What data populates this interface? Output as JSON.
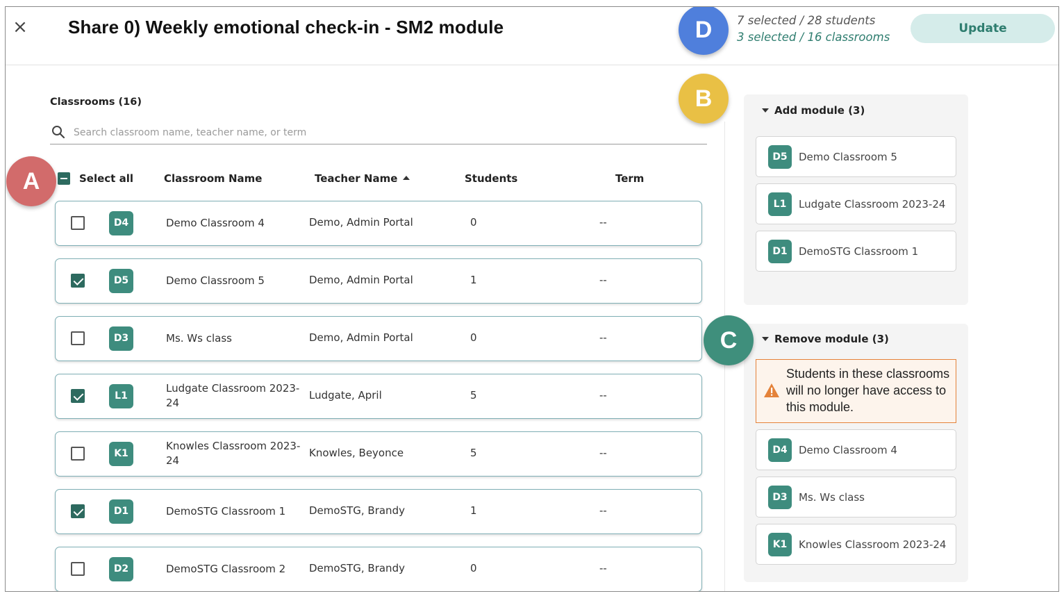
{
  "header": {
    "close_glyph": "×",
    "title": "Share 0) Weekly emotional check-in - SM2 module",
    "selection_students": "7 selected / 28 students",
    "selection_classrooms": "3 selected / 16 classrooms",
    "update_label": "Update"
  },
  "classrooms": {
    "heading": "Classrooms (16)",
    "search_placeholder": "Search classroom name, teacher name, or term",
    "columns": {
      "select_all": "Select all",
      "classroom_name": "Classroom Name",
      "teacher_name": "Teacher Name",
      "students": "Students",
      "term": "Term"
    },
    "rows": [
      {
        "badge": "D4",
        "name": "Demo Classroom 4",
        "teacher": "Demo, Admin Portal",
        "students": "0",
        "term": "--",
        "checked": false
      },
      {
        "badge": "D5",
        "name": "Demo Classroom 5",
        "teacher": "Demo, Admin Portal",
        "students": "1",
        "term": "--",
        "checked": true
      },
      {
        "badge": "D3",
        "name": "Ms. Ws class",
        "teacher": "Demo, Admin Portal",
        "students": "0",
        "term": "--",
        "checked": false
      },
      {
        "badge": "L1",
        "name": "Ludgate Classroom 2023-24",
        "teacher": "Ludgate, April",
        "students": "5",
        "term": "--",
        "checked": true
      },
      {
        "badge": "K1",
        "name": "Knowles Classroom 2023-24",
        "teacher": "Knowles, Beyonce",
        "students": "5",
        "term": "--",
        "checked": false
      },
      {
        "badge": "D1",
        "name": "DemoSTG Classroom 1",
        "teacher": "DemoSTG, Brandy",
        "students": "1",
        "term": "--",
        "checked": true
      },
      {
        "badge": "D2",
        "name": "DemoSTG Classroom 2",
        "teacher": "DemoSTG, Brandy",
        "students": "0",
        "term": "--",
        "checked": false
      }
    ]
  },
  "add_module": {
    "heading": "Add module (3)",
    "items": [
      {
        "badge": "D5",
        "name": "Demo Classroom 5"
      },
      {
        "badge": "L1",
        "name": "Ludgate Classroom 2023-24"
      },
      {
        "badge": "D1",
        "name": "DemoSTG Classroom 1"
      }
    ]
  },
  "remove_module": {
    "heading": "Remove module (3)",
    "warning": "Students in these classrooms will no longer have access to this module.",
    "items": [
      {
        "badge": "D4",
        "name": "Demo Classroom 4"
      },
      {
        "badge": "D3",
        "name": "Ms. Ws class"
      },
      {
        "badge": "K1",
        "name": "Knowles Classroom 2023-24"
      }
    ]
  },
  "callouts": [
    {
      "label": "A",
      "color": "#d26b6b"
    },
    {
      "label": "B",
      "color": "#e9c045"
    },
    {
      "label": "C",
      "color": "#3f8f7c"
    },
    {
      "label": "D",
      "color": "#4f7fdc"
    }
  ],
  "colors": {
    "accent": "#2d6a5f",
    "badge": "#3e8c7e",
    "update_bg": "#d5ecea",
    "warning_border": "#e4823a"
  }
}
